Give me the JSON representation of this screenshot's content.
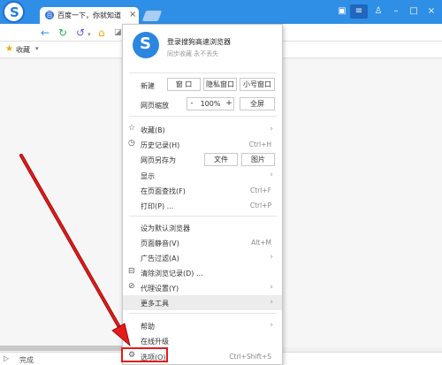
{
  "tab": {
    "favicon": "百",
    "title": "百度一下，你就知道",
    "close": "×"
  },
  "bookmarks": {
    "label": "收藏"
  },
  "status": {
    "text": "完成"
  },
  "menu": {
    "login_title": "登录搜狗高速浏览器",
    "login_subtitle": "同步收藏 永不丢失",
    "new": {
      "label": "新建",
      "window": "窗 口",
      "private": "隐私窗口",
      "small": "小号窗口"
    },
    "zoom": {
      "label": "网页缩放",
      "minus": "-",
      "value": "100%",
      "plus": "+",
      "fullscreen": "全屏"
    },
    "save_as": {
      "label": "网页另存为",
      "file": "文件",
      "image": "图片"
    },
    "items": [
      {
        "icon": "☆",
        "label": "收藏(B)",
        "shortcut": "",
        "arrow": "›"
      },
      {
        "icon": "◷",
        "label": "历史记录(H)",
        "shortcut": "Ctrl+H",
        "arrow": ""
      },
      {
        "icon": "",
        "label": "显示",
        "shortcut": "",
        "arrow": "›"
      },
      {
        "icon": "",
        "label": "在页面查找(F)",
        "shortcut": "Ctrl+F",
        "arrow": ""
      },
      {
        "icon": "",
        "label": "打印(P) ...",
        "shortcut": "Ctrl+P",
        "arrow": ""
      },
      {
        "icon": "",
        "label": "设为默认浏览器",
        "shortcut": "",
        "arrow": ""
      },
      {
        "icon": "",
        "label": "页面静音(V)",
        "shortcut": "Alt+M",
        "arrow": ""
      },
      {
        "icon": "",
        "label": "广告过滤(A)",
        "shortcut": "",
        "arrow": "›"
      },
      {
        "icon": "⊟",
        "label": "清除浏览记录(D) ...",
        "shortcut": "",
        "arrow": ""
      },
      {
        "icon": "⊘",
        "label": "代理设置(Y)",
        "shortcut": "",
        "arrow": "›"
      },
      {
        "icon": "",
        "label": "更多工具",
        "shortcut": "",
        "arrow": "›"
      },
      {
        "icon": "",
        "label": "帮助",
        "shortcut": "",
        "arrow": "›"
      },
      {
        "icon": "",
        "label": "在线升级",
        "shortcut": "",
        "arrow": ""
      },
      {
        "icon": "⚙",
        "label": "选项(O)",
        "shortcut": "Ctrl+Shift+S",
        "arrow": ""
      }
    ]
  },
  "colors": {
    "titlebar": "#2f8fe6",
    "highlight": "#e31b1b"
  }
}
